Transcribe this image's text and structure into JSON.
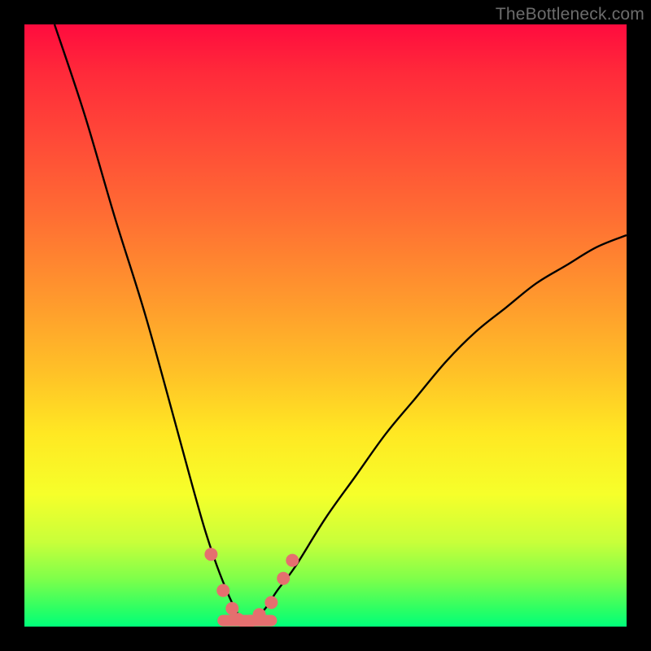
{
  "watermark": {
    "text": "TheBottleneck.com"
  },
  "gradient": {
    "top": "#ff0b3e",
    "mid_upper": "#ff9a2d",
    "mid_lower": "#ffe823",
    "bottom": "#00ff7a"
  },
  "chart_data": {
    "type": "line",
    "title": "",
    "xlabel": "",
    "ylabel": "",
    "xlim": [
      0,
      100
    ],
    "ylim": [
      0,
      100
    ],
    "grid": false,
    "legend": false,
    "series": [
      {
        "name": "bottleneck-curve",
        "color": "#000000",
        "x": [
          5,
          10,
          15,
          20,
          25,
          28,
          30,
          32,
          34,
          35,
          36,
          37,
          38,
          40,
          42,
          45,
          50,
          55,
          60,
          65,
          70,
          75,
          80,
          85,
          90,
          95,
          100
        ],
        "values": [
          100,
          85,
          68,
          52,
          34,
          23,
          16,
          10,
          5,
          3,
          1,
          0,
          1,
          3,
          6,
          10,
          18,
          25,
          32,
          38,
          44,
          49,
          53,
          57,
          60,
          63,
          65
        ]
      }
    ],
    "markers": {
      "name": "highlighted-points",
      "color": "#e56f6f",
      "radius_px": 8,
      "x": [
        31,
        33,
        34.5,
        35.5,
        36.5,
        37.5,
        39,
        41,
        43,
        44.5
      ],
      "values": [
        12,
        6,
        3,
        1.2,
        0.8,
        0.9,
        2,
        4,
        8,
        11
      ]
    },
    "trough_band": {
      "name": "valley-band",
      "color": "#e56f6f",
      "thickness_px": 14,
      "x_range": [
        33,
        41
      ],
      "y": 1
    }
  }
}
